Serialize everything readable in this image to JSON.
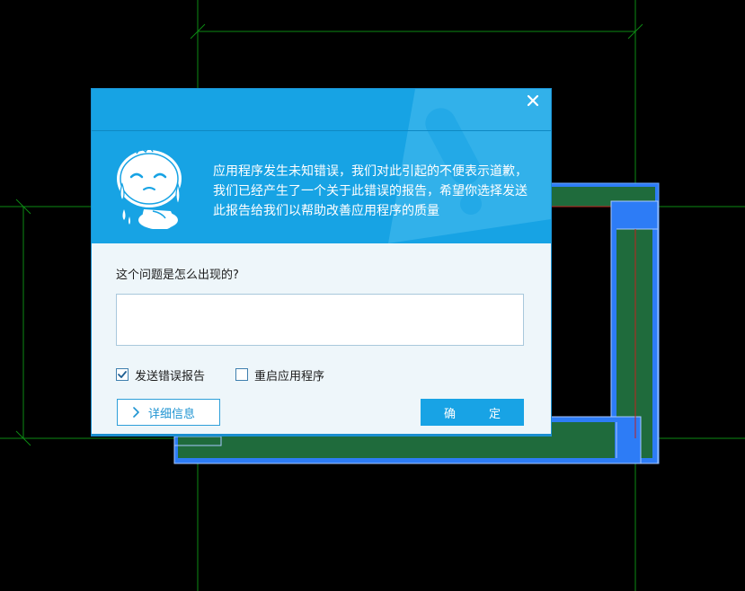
{
  "window": {
    "title": ""
  },
  "dialog": {
    "message": "应用程序发生未知错误，我们对此引起的不便表示道歉，我们已经产生了一个关于此错误的报告，希望你选择发送此报告给我们以帮助改善应用程序的质量",
    "question": "这个问题是怎么出现的?",
    "description": {
      "value": "",
      "placeholder": ""
    },
    "options": {
      "send_report": {
        "label": "发送错误报告",
        "checked": true
      },
      "restart_app": {
        "label": "重启应用程序",
        "checked": false
      }
    },
    "buttons": {
      "details": "详细信息",
      "ok": "确　定"
    },
    "icons": {
      "close": "close-icon",
      "mascot": "crying-mascot-icon",
      "watermark": "warning-triangle-icon",
      "details": "chevron-right-icon",
      "check": "checkmark-icon"
    },
    "colors": {
      "header": "#17a3e4",
      "body": "#eef6fa",
      "accent": "#18a3e5",
      "cad_background": "#000000",
      "cad_grid": "#0a7a12",
      "cad_selection": "#2d7cf6",
      "cad_fill": "#1f6b3c"
    }
  }
}
